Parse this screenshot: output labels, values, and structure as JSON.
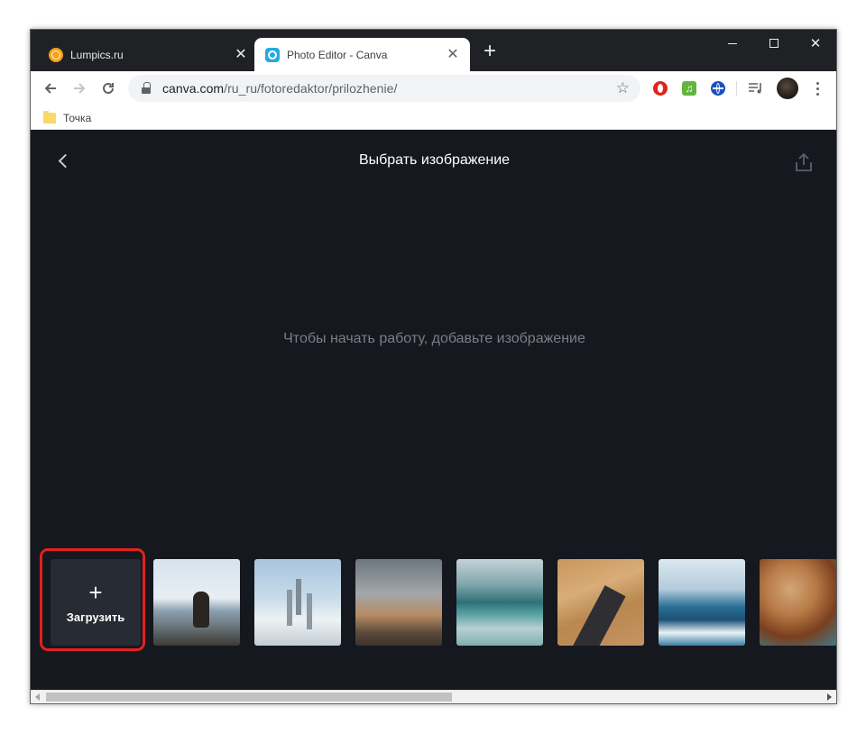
{
  "browser": {
    "tabs": [
      {
        "title": "Lumpics.ru",
        "favicon": "lumpics-favicon",
        "active": false
      },
      {
        "title": "Photo Editor - Canva",
        "favicon": "canva-favicon",
        "active": true
      }
    ],
    "new_tab": "+",
    "url_host": "canva.com",
    "url_path": "/ru_ru/fotoredaktor/prilozhenie/",
    "bookmarks": [
      {
        "label": "Точка",
        "icon": "folder-icon"
      }
    ],
    "extensions": [
      "opera-icon",
      "music-icon",
      "globe-icon",
      "media-queue-icon"
    ]
  },
  "canva": {
    "title": "Выбрать изображение",
    "hint": "Чтобы начать работу, добавьте изображение",
    "upload": {
      "plus": "+",
      "label": "Загрузить"
    },
    "thumbnails": [
      "woman-sitting-on-rocks-by-sea",
      "city-above-clouds",
      "rock-with-trees-under-cloudy-sky",
      "mountain-lake-reflection",
      "desert-road-aerial",
      "surfer-on-wave",
      "abstract-orange-teal"
    ]
  },
  "colors": {
    "page_bg": "#15181e",
    "upload_bg": "#272b33",
    "highlight_red": "#e0211e",
    "hint_text": "#7a7f87"
  }
}
